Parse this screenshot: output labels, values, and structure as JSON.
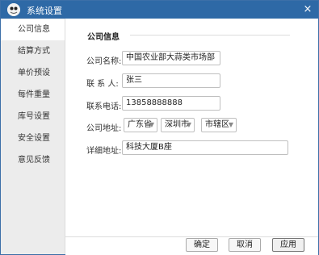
{
  "window": {
    "title": "系统设置",
    "accent": "#2e69a6"
  },
  "sidebar": {
    "items": [
      {
        "label": "公司信息",
        "active": true
      },
      {
        "label": "结算方式"
      },
      {
        "label": "单价预设"
      },
      {
        "label": "每件重量"
      },
      {
        "label": "库号设置"
      },
      {
        "label": "安全设置"
      },
      {
        "label": "意见反馈"
      }
    ]
  },
  "form": {
    "section_title": "公司信息",
    "company_name": {
      "label": "公司名称:",
      "value": "中国农业部大蒜类市场部"
    },
    "contact": {
      "label": "联 系 人:",
      "value": "张三"
    },
    "phone": {
      "label": "联系电话:",
      "value": "13858888888"
    },
    "address": {
      "label": "公司地址:",
      "province": "广东省",
      "city": "深圳市",
      "district": "市辖区"
    },
    "detail_address": {
      "label": "详细地址:",
      "value": "科技大厦B座"
    }
  },
  "footer": {
    "ok_label": "确定",
    "cancel_label": "取消",
    "apply_label": "应用"
  }
}
